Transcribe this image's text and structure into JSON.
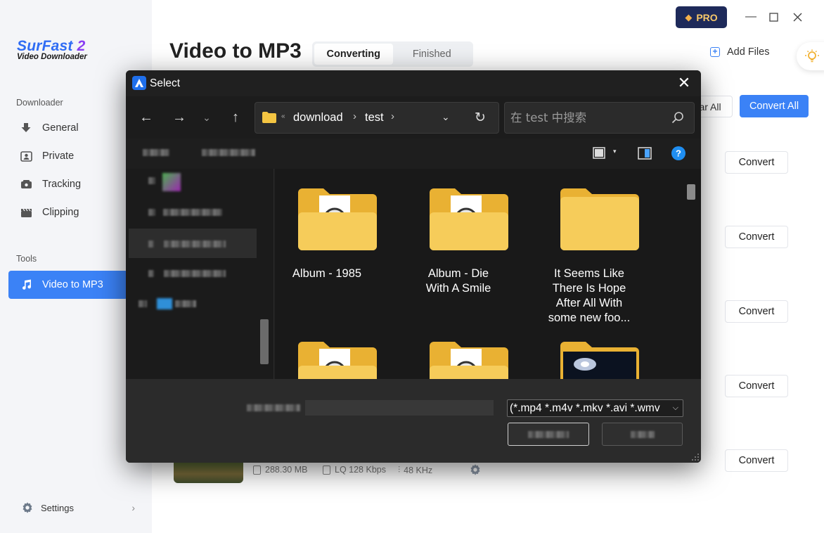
{
  "app": {
    "logo_title": "SurFast",
    "logo_version": "2",
    "logo_subtitle": "Video Downloader",
    "page_title": "Video to MP3",
    "tabs": [
      "Converting",
      "Finished"
    ],
    "pro_label": "PRO",
    "add_files": "Add Files",
    "clear_all": "ar All",
    "convert_all": "Convert All",
    "convert_label": "Convert",
    "settings_label": "Settings",
    "accent": "#3b82f6"
  },
  "sidebar": {
    "downloader_label": "Downloader",
    "downloader_items": [
      "General",
      "Private",
      "Tracking",
      "Clipping"
    ],
    "tools_label": "Tools",
    "tools_items": [
      "Video to MP3"
    ]
  },
  "item_meta": {
    "size": "288.30 MB",
    "quality": "LQ 128 Kbps",
    "rate": "48 KHz"
  },
  "dialog": {
    "title": "Select",
    "breadcrumb": [
      "download",
      "test"
    ],
    "search_placeholder": "在 test 中搜索",
    "folders": [
      {
        "label": "Album - 1985",
        "icon": "media-folder-icon"
      },
      {
        "label": "Album - Die With A Smile",
        "icon": "media-folder-icon"
      },
      {
        "label": "It Seems Like There Is Hope After All With some new foo...",
        "icon": "folder-icon"
      },
      {
        "label": "",
        "icon": "media-folder-icon"
      },
      {
        "label": "",
        "icon": "media-folder-icon"
      },
      {
        "label": "",
        "icon": "video-folder-icon"
      }
    ],
    "file_type": "(*.mp4 *.m4v *.mkv *.avi *.wmv"
  }
}
